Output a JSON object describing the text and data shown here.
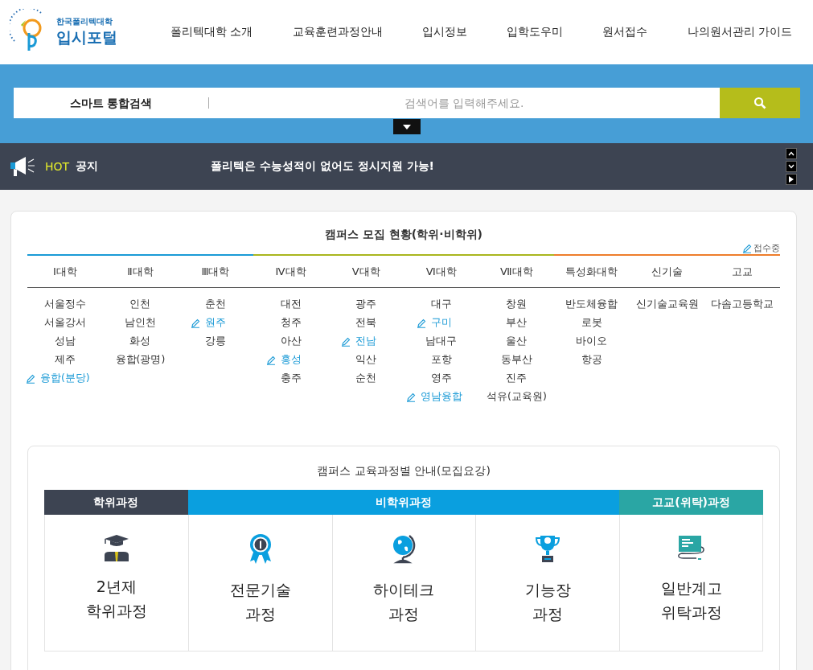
{
  "logo": {
    "subtitle": "한국폴리텍대학",
    "title": "입시포털"
  },
  "nav": [
    "폴리텍대학 소개",
    "교육훈련과정안내",
    "입시정보",
    "입학도우미",
    "원서접수",
    "나의원서관리 가이드"
  ],
  "search": {
    "label": "스마트 통합검색",
    "placeholder": "검색어를 입력해주세요."
  },
  "notice": {
    "tag": "HOT",
    "title": "공지",
    "text": "폴리텍은 수능성적이 없어도 정시지원 가능!"
  },
  "campus": {
    "title": "캠퍼스 모집 현황(학위·비학위)",
    "status_label": "접수중",
    "columns": [
      {
        "name": "Ⅰ대학",
        "color": "#1a9ad6",
        "items": [
          {
            "name": "서울정수",
            "receiving": false
          },
          {
            "name": "서울강서",
            "receiving": false
          },
          {
            "name": "성남",
            "receiving": false
          },
          {
            "name": "제주",
            "receiving": false
          },
          {
            "name": "융합(분당)",
            "receiving": true
          }
        ]
      },
      {
        "name": "Ⅱ대학",
        "color": "#1a9ad6",
        "items": [
          {
            "name": "인천",
            "receiving": false
          },
          {
            "name": "남인천",
            "receiving": false
          },
          {
            "name": "화성",
            "receiving": false
          },
          {
            "name": "융합(광명)",
            "receiving": false
          }
        ]
      },
      {
        "name": "Ⅲ대학",
        "color": "#1a9ad6",
        "items": [
          {
            "name": "춘천",
            "receiving": false
          },
          {
            "name": "원주",
            "receiving": true
          },
          {
            "name": "강릉",
            "receiving": false
          }
        ]
      },
      {
        "name": "Ⅳ대학",
        "color": "#a9b61e",
        "items": [
          {
            "name": "대전",
            "receiving": false
          },
          {
            "name": "청주",
            "receiving": false
          },
          {
            "name": "아산",
            "receiving": false
          },
          {
            "name": "홍성",
            "receiving": true
          },
          {
            "name": "충주",
            "receiving": false
          }
        ]
      },
      {
        "name": "Ⅴ대학",
        "color": "#a9b61e",
        "items": [
          {
            "name": "광주",
            "receiving": false
          },
          {
            "name": "전북",
            "receiving": false
          },
          {
            "name": "전남",
            "receiving": true
          },
          {
            "name": "익산",
            "receiving": false
          },
          {
            "name": "순천",
            "receiving": false
          }
        ]
      },
      {
        "name": "Ⅵ대학",
        "color": "#a9b61e",
        "items": [
          {
            "name": "대구",
            "receiving": false
          },
          {
            "name": "구미",
            "receiving": true
          },
          {
            "name": "남대구",
            "receiving": false
          },
          {
            "name": "포항",
            "receiving": false
          },
          {
            "name": "영주",
            "receiving": false
          },
          {
            "name": "영남융합",
            "receiving": true
          }
        ]
      },
      {
        "name": "Ⅶ대학",
        "color": "#a9b61e",
        "items": [
          {
            "name": "창원",
            "receiving": false
          },
          {
            "name": "부산",
            "receiving": false
          },
          {
            "name": "울산",
            "receiving": false
          },
          {
            "name": "동부산",
            "receiving": false
          },
          {
            "name": "진주",
            "receiving": false
          },
          {
            "name": "석유(교육원)",
            "receiving": false
          }
        ]
      },
      {
        "name": "특성화대학",
        "color": "#ee7d2b",
        "items": [
          {
            "name": "반도체융합",
            "receiving": false
          },
          {
            "name": "로봇",
            "receiving": false
          },
          {
            "name": "바이오",
            "receiving": false
          },
          {
            "name": "항공",
            "receiving": false
          }
        ]
      },
      {
        "name": "신기술",
        "color": "#ee7d2b",
        "items": [
          {
            "name": "신기술교육원",
            "receiving": false
          }
        ]
      },
      {
        "name": "고교",
        "color": "#ee7d2b",
        "items": [
          {
            "name": "다솜고등학교",
            "receiving": false
          }
        ]
      }
    ]
  },
  "courses": {
    "title": "캠퍼스 교육과정별 안내(모집요강)",
    "groups": [
      {
        "label": "학위과정",
        "color": "#3d4452",
        "items": [
          {
            "kind": "graduate",
            "lines": [
              "2년제",
              "학위과정"
            ]
          }
        ]
      },
      {
        "label": "비학위과정",
        "color": "#0a9fdf",
        "items": [
          {
            "kind": "medal",
            "lines": [
              "전문기술",
              "과정"
            ]
          },
          {
            "kind": "globe",
            "lines": [
              "하이테크",
              "과정"
            ]
          },
          {
            "kind": "trophy",
            "lines": [
              "기능장",
              "과정"
            ]
          }
        ]
      },
      {
        "label": "고교(위탁)과정",
        "color": "#2aa6a4",
        "items": [
          {
            "kind": "book",
            "lines": [
              "일반계고",
              "위탁과정"
            ]
          }
        ]
      }
    ]
  }
}
